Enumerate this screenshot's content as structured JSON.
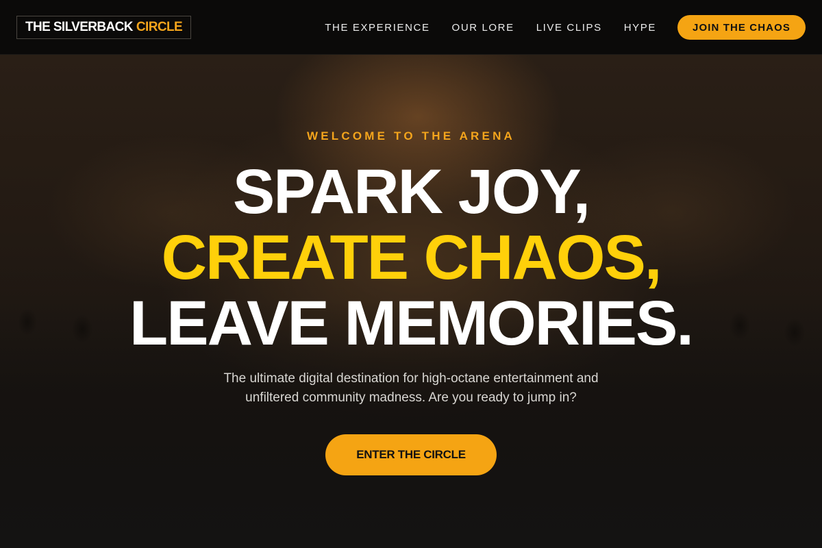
{
  "brand": {
    "name_white": "THE SILVERBACK",
    "name_accent": "CIRCLE",
    "accent_color": "#f4a51c"
  },
  "nav": {
    "links": [
      "THE EXPERIENCE",
      "OUR LORE",
      "LIVE CLIPS",
      "HYPE"
    ],
    "cta_label": "JOIN THE CHAOS"
  },
  "hero": {
    "eyebrow": "WELCOME TO THE ARENA",
    "headline_line1": "SPARK JOY,",
    "headline_line2": "CREATE CHAOS,",
    "headline_line3": "LEAVE MEMORIES.",
    "subtext_line1": "The ultimate digital destination for high-octane entertainment and",
    "subtext_line2": "unfiltered community madness. Are you ready to jump in?",
    "cta_label": "ENTER THE CIRCLE",
    "highlight_color": "#ffd00a",
    "button_color": "#f5a413"
  }
}
